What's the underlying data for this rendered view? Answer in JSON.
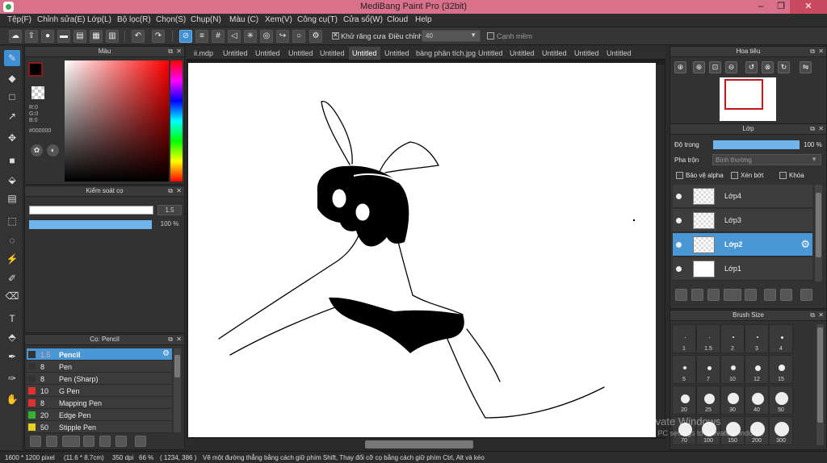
{
  "window": {
    "title": "MediBang Paint Pro (32bit)",
    "minimize": "–",
    "maximize": "❐",
    "close": "✕"
  },
  "menu": [
    "Tệp(F)",
    "Chỉnh sửa(E)",
    "Lớp(L)",
    "Bộ lọc(R)",
    "Chọn(S)",
    "Chụp(N)",
    "Màu (C)",
    "Xem(V)",
    "Công cụ(T)",
    "Cửa sổ(W)",
    "Cloud",
    "Help"
  ],
  "toolbar": {
    "antialias_label": "Khử răng cưa",
    "antialias_checked": true,
    "correction_label": "Điều chỉnh",
    "correction_value": "40",
    "smooth_label": "Cạnh mềm",
    "smooth_checked": false
  },
  "color_panel": {
    "title": "Màu",
    "r": "R:0",
    "g": "G:0",
    "b": "B:0",
    "hex": "#000000",
    "fg_color": "#000000"
  },
  "brush_control": {
    "title": "Kiểm soát cọ",
    "size_value": "1.5",
    "opacity_value": "100 %"
  },
  "brush_list": {
    "title": "Cọ: Pencil",
    "items": [
      {
        "size": "1.5",
        "name": "Pencil",
        "color": "#333333",
        "selected": true
      },
      {
        "size": "8",
        "name": "Pen",
        "color": "#333333"
      },
      {
        "size": "8",
        "name": "Pen (Sharp)",
        "color": "#333333"
      },
      {
        "size": "10",
        "name": "G Pen",
        "color": "#e03030"
      },
      {
        "size": "8",
        "name": "Mapping Pen",
        "color": "#e03030"
      },
      {
        "size": "20",
        "name": "Edge Pen",
        "color": "#2fb52f"
      },
      {
        "size": "50",
        "name": "Stipple Pen",
        "color": "#e6d21b"
      }
    ]
  },
  "tabs": [
    "ii.mdp",
    "Untitled",
    "Untitled",
    "Untitled",
    "Untitled",
    "Untitled",
    "Untitled",
    "bảng phân tích.jpg",
    "Untitled",
    "Untitled",
    "Untitled",
    "Untitled",
    "Untitled"
  ],
  "active_tab": 5,
  "navigator": {
    "title": "Hoa tiêu"
  },
  "layers": {
    "title": "Lớp",
    "opacity_label": "Độ trong",
    "opacity_value": "100 %",
    "opacity_fraction": 1.0,
    "blend_label": "Pha trộn",
    "blend_value": "Bình thường",
    "alpha_label": "Bảo vệ alpha",
    "clip_label": "Xén bớt",
    "lock_label": "Khóa",
    "items": [
      {
        "name": "Lớp4"
      },
      {
        "name": "Lớp3"
      },
      {
        "name": "Lớp2",
        "selected": true
      },
      {
        "name": "Lớp1"
      }
    ]
  },
  "brush_size": {
    "title": "Brush Size",
    "rows": [
      [
        "1",
        "1.5",
        "2",
        "3",
        "4"
      ],
      [
        "5",
        "7",
        "10",
        "12",
        "15"
      ],
      [
        "20",
        "25",
        "30",
        "40",
        "50"
      ],
      [
        "70",
        "100",
        "150",
        "200",
        "300"
      ]
    ]
  },
  "watermark": {
    "line1": "Activate Windows",
    "line2": "Go to PC settings to activate Windows."
  },
  "status": {
    "dimensions": "1600 * 1200 pixel",
    "physical": "(11.6 * 8.7cm)",
    "dpi": "350 dpi",
    "zoom": "66 %",
    "coords": "( 1234, 386 )",
    "hint": "Vẽ một đường thẳng bằng cách giữ phím Shift, Thay đổi cỡ cọ bằng cách giữ phím Ctrl, Alt và kéo"
  },
  "colors": {
    "title_bg": "#d9718b",
    "accent": "#4a97d6",
    "panel": "#323232"
  }
}
